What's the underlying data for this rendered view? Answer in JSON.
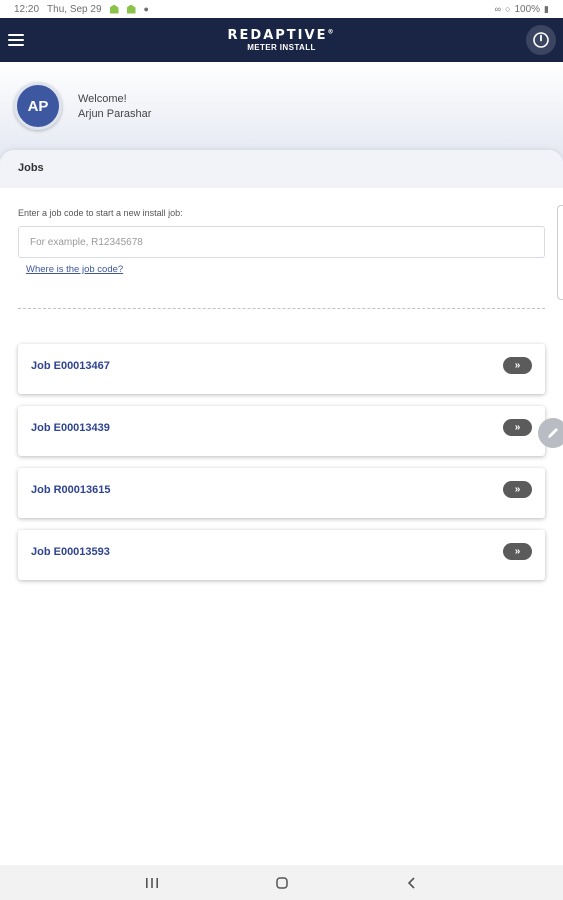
{
  "status_bar": {
    "time": "12:20",
    "date": "Thu, Sep 29",
    "battery": "100%"
  },
  "app_bar": {
    "brand": "REDAPTIVE",
    "brand_mark": "®",
    "subtitle": "METER INSTALL"
  },
  "user": {
    "initials": "AP",
    "welcome": "Welcome!",
    "name": "Arjun Parashar"
  },
  "jobs": {
    "header": "Jobs",
    "prompt": "Enter a job code to start a new install job:",
    "input_placeholder": "For example, R12345678",
    "input_value": "",
    "help_link": "Where is the job code?",
    "items": [
      {
        "label": "Job E00013467",
        "arrow": "»"
      },
      {
        "label": "Job E00013439",
        "arrow": "»"
      },
      {
        "label": "Job R00013615",
        "arrow": "»"
      },
      {
        "label": "Job E00013593",
        "arrow": "»"
      }
    ]
  },
  "colors": {
    "app_bar": "#1a2444",
    "avatar": "#3d57a0",
    "job_text": "#2f4490",
    "arrow_badge": "#5b5b5b"
  },
  "icons": {
    "menu": "hamburger-icon",
    "power": "power-icon",
    "edit": "pencil-icon",
    "nav_recents": "recents-icon",
    "nav_home": "home-icon",
    "nav_back": "back-icon"
  }
}
